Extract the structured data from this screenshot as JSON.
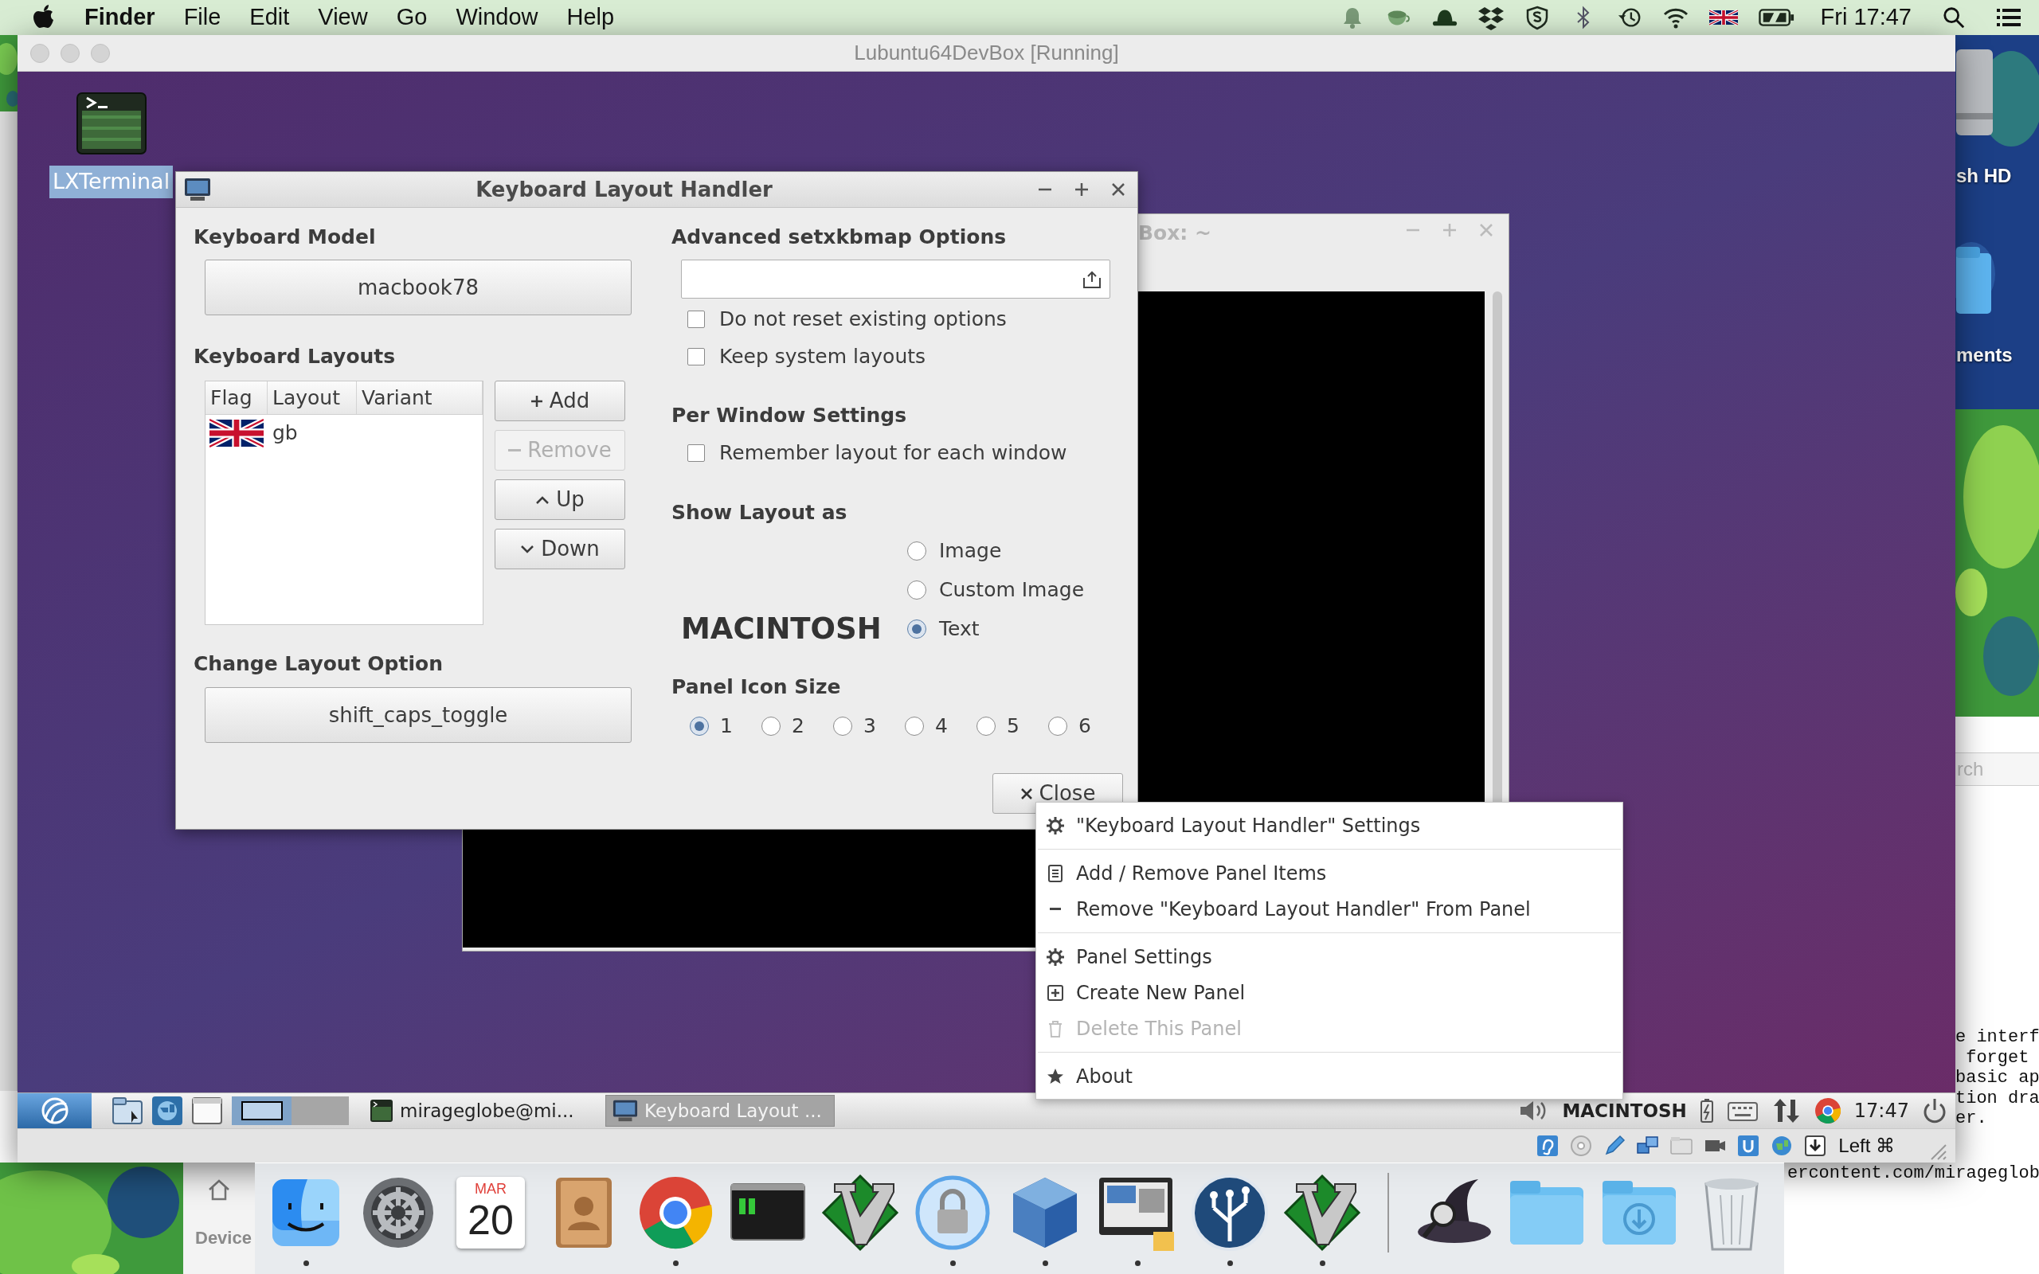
{
  "menu_bar": {
    "app": "Finder",
    "items": [
      "File",
      "Edit",
      "View",
      "Go",
      "Window",
      "Help"
    ],
    "clock": "Fri 17:47"
  },
  "host_desktop": {
    "icons": [
      {
        "kind": "disk",
        "label": "sh HD"
      },
      {
        "kind": "folder",
        "label": "ments"
      }
    ]
  },
  "host_sidebar": {
    "section": "Device"
  },
  "host_window": {
    "search_placeholder": "rch",
    "lines": [
      "e interf",
      " forget",
      "basic ap",
      "tion dra",
      "er."
    ],
    "url_line": "ercontent.com/mirageglob"
  },
  "vm_window": {
    "title": "Lubuntu64DevBox [Running]",
    "host_key": "Left ⌘"
  },
  "guest_desktop": {
    "icons": [
      {
        "label": "LXTerminal",
        "selected": true
      }
    ]
  },
  "terminal_window": {
    "title": "Box: ~"
  },
  "dialog": {
    "title": "Keyboard Layout Handler",
    "keyboard_model": {
      "label": "Keyboard Model",
      "value": "macbook78"
    },
    "layouts": {
      "label": "Keyboard Layouts",
      "columns": [
        "Flag",
        "Layout",
        "Variant"
      ],
      "rows": [
        {
          "layout": "gb"
        }
      ]
    },
    "layout_buttons": [
      {
        "kind": "add",
        "label": "Add",
        "disabled": false
      },
      {
        "kind": "remove",
        "label": "Remove",
        "disabled": true
      },
      {
        "kind": "up",
        "label": "Up",
        "disabled": false
      },
      {
        "kind": "down",
        "label": "Down",
        "disabled": false
      }
    ],
    "change_layout": {
      "label": "Change Layout Option",
      "value": "shift_caps_toggle"
    },
    "advanced": {
      "label": "Advanced setxkbmap Options",
      "options": [
        {
          "label": "Do not reset existing options",
          "checked": false
        },
        {
          "label": "Keep system layouts",
          "checked": false
        }
      ]
    },
    "per_window": {
      "label": "Per Window Settings",
      "options": [
        {
          "label": "Remember layout for each window",
          "checked": false
        }
      ]
    },
    "show_layout": {
      "label": "Show Layout as",
      "preview": "MACINTOSH",
      "options": [
        {
          "label": "Image",
          "selected": false
        },
        {
          "label": "Custom Image",
          "selected": false
        },
        {
          "label": "Text",
          "selected": true
        }
      ]
    },
    "icon_size": {
      "label": "Panel Icon Size",
      "options": [
        {
          "label": "1",
          "selected": true
        },
        {
          "label": "2",
          "selected": false
        },
        {
          "label": "3",
          "selected": false
        },
        {
          "label": "4",
          "selected": false
        },
        {
          "label": "5",
          "selected": false
        },
        {
          "label": "6",
          "selected": false
        }
      ]
    },
    "close_button": "Close"
  },
  "context_menu": {
    "items": [
      {
        "kind": "gear",
        "label": "\"Keyboard Layout Handler\" Settings",
        "disabled": false
      },
      {
        "kind": "separator"
      },
      {
        "kind": "list",
        "label": "Add / Remove Panel Items",
        "disabled": false
      },
      {
        "kind": "minus",
        "label": "Remove \"Keyboard Layout Handler\" From Panel",
        "disabled": false
      },
      {
        "kind": "separator"
      },
      {
        "kind": "gear",
        "label": "Panel Settings",
        "disabled": false
      },
      {
        "kind": "plus",
        "label": "Create New Panel",
        "disabled": false
      },
      {
        "kind": "trash",
        "label": "Delete This Panel",
        "disabled": true
      },
      {
        "kind": "separator"
      },
      {
        "kind": "star",
        "label": "About",
        "disabled": false
      }
    ]
  },
  "panel": {
    "tasks": [
      {
        "kind": "terminal",
        "label": "mirageglobe@mi...",
        "selected": false
      },
      {
        "kind": "monitor",
        "label": "Keyboard Layout ...",
        "selected": true
      }
    ],
    "layout": "MACINTOSH",
    "clock": "17:47"
  },
  "dock": {
    "items": [
      {
        "kind": "finder",
        "running": true
      },
      {
        "kind": "settings",
        "running": false
      },
      {
        "kind": "calendar",
        "month": "MAR",
        "day": "20",
        "running": false
      },
      {
        "kind": "contacts",
        "running": false
      },
      {
        "kind": "browser",
        "running": true
      },
      {
        "kind": "terminal",
        "running": false
      },
      {
        "kind": "vim",
        "running": false
      },
      {
        "kind": "lock",
        "running": true
      },
      {
        "kind": "cube",
        "running": true
      },
      {
        "kind": "screenshot",
        "running": true
      },
      {
        "kind": "tree",
        "running": true
      },
      {
        "kind": "vim",
        "running": true
      },
      {
        "kind": "separator"
      },
      {
        "kind": "hat",
        "running": false
      },
      {
        "kind": "folder",
        "running": false
      },
      {
        "kind": "downloads",
        "running": false
      },
      {
        "kind": "trash",
        "running": false
      }
    ]
  }
}
